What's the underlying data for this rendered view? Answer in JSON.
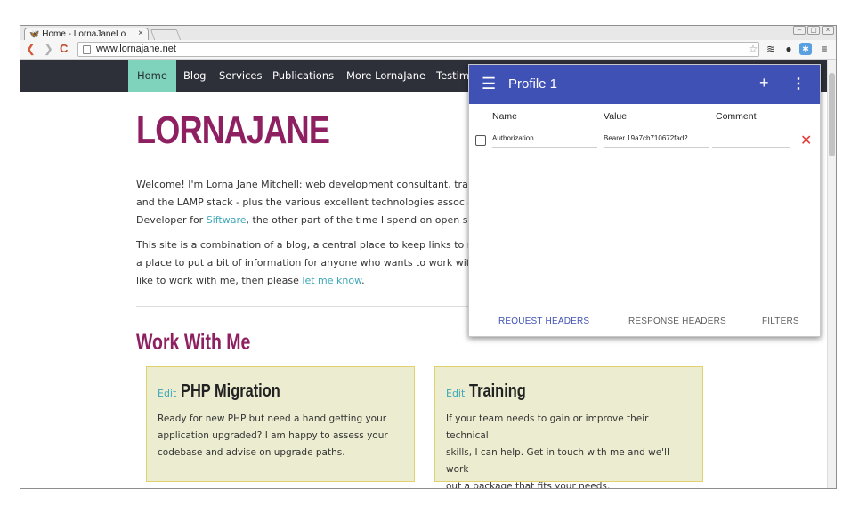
{
  "browser": {
    "tab_title": "Home - LornaJaneLo",
    "tab_close": "×",
    "url": "www.lornajane.net",
    "win_buttons": [
      "–",
      "▢",
      "×"
    ]
  },
  "site": {
    "nav": [
      "Home",
      "Blog",
      "Services",
      "Publications",
      "More LornaJane",
      "Testimo"
    ],
    "logo": "LORNAJANE",
    "intro_lines": [
      "Welcome! I'm Lorna Jane Mitchell: web development consultant, trainer and",
      "and the LAMP stack - plus the various excellent technologies associated wit",
      "Developer for "
    ],
    "intro_link": "Siftware",
    "intro_tail": ", the other part of the time I spend on open source ac",
    "second_lines": [
      "This site is a combination of a blog, a central place to keep links to my book",
      "a place to put a bit of information for anyone who wants to work with me. I",
      "like to work with me, then please "
    ],
    "second_link": "let me know",
    "second_tail": ".",
    "work_title": "Work With Me",
    "cards": [
      {
        "edit": "Edit",
        "title": "PHP Migration",
        "body": [
          "Ready for new PHP but need a hand getting your",
          "application upgraded? I am happy to assess your",
          "codebase and advise on upgrade paths."
        ]
      },
      {
        "edit": "Edit",
        "title": "Training",
        "body": [
          "If your team needs to gain or improve their technical",
          "skills, I can help. Get in touch with me and we'll work",
          "out a package that fits your needs."
        ]
      }
    ]
  },
  "popup": {
    "title": "Profile 1",
    "columns": [
      "Name",
      "Value",
      "Comment"
    ],
    "header_row": {
      "name": "Authorization",
      "value": "Bearer 19a7cb710672fad2",
      "comment": "",
      "checked": false
    },
    "tabs": [
      "REQUEST HEADERS",
      "RESPONSE HEADERS",
      "FILTERS"
    ],
    "active_tab": "REQUEST HEADERS",
    "accent_color": "#3f51b5",
    "delete_color": "#e53935"
  },
  "colors": {
    "brand": "#8e2061",
    "nav_bg": "#2e3039",
    "nav_active": "#7fd3bd",
    "link": "#3ea7b8",
    "card_bg": "#ececd0"
  }
}
